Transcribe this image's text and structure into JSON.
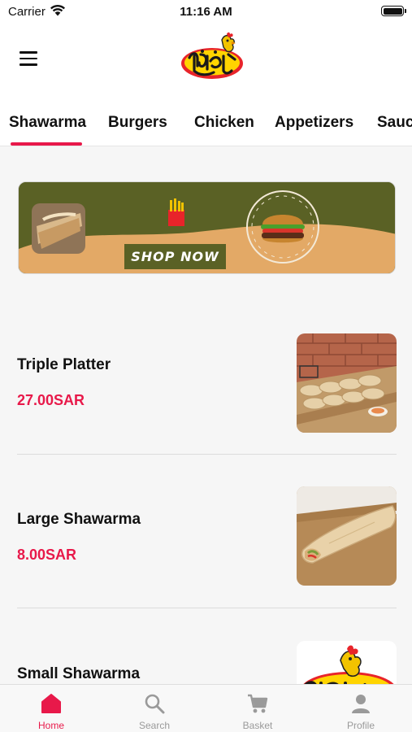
{
  "status_bar": {
    "carrier": "Carrier",
    "time": "11:16 AM"
  },
  "header": {
    "menu_icon": "hamburger-menu-icon",
    "logo": "restaurant-logo-rooster"
  },
  "tabs": {
    "active_index": 0,
    "items": [
      {
        "label": "Shawarma"
      },
      {
        "label": "Burgers"
      },
      {
        "label": "Chicken"
      },
      {
        "label": "Appetizers"
      },
      {
        "label": "Sauc"
      }
    ]
  },
  "banner": {
    "button_label": "SHOP NOW",
    "colors": {
      "olive": "#5a6125",
      "tan": "#e3a966"
    }
  },
  "menu_items": [
    {
      "name": "Triple Platter",
      "price": "27.00SAR"
    },
    {
      "name": "Large Shawarma",
      "price": "8.00SAR"
    },
    {
      "name": "Small Shawarma",
      "price": ""
    }
  ],
  "bottom_nav": {
    "active_index": 0,
    "items": [
      {
        "label": "Home",
        "icon": "home-icon"
      },
      {
        "label": "Search",
        "icon": "search-icon"
      },
      {
        "label": "Basket",
        "icon": "cart-icon"
      },
      {
        "label": "Profile",
        "icon": "profile-icon"
      }
    ]
  },
  "colors": {
    "accent": "#e8194a",
    "inactive": "#9a9a9a"
  }
}
